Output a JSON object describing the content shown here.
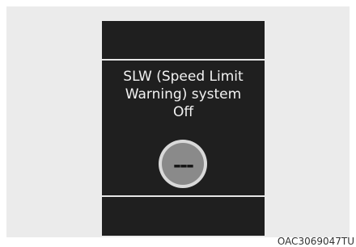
{
  "display": {
    "message_line1": "SLW (Speed Limit",
    "message_line2": "Warning) system",
    "message_line3": "Off",
    "icon": "speed-limit-off-icon",
    "icon_value": "---"
  },
  "caption": "OAC3069047TU",
  "colors": {
    "screen_background": "#1f1f1f",
    "panel_background": "#ebebeb",
    "text": "#f2f2f2",
    "icon_fill": "#8a8a8a"
  }
}
